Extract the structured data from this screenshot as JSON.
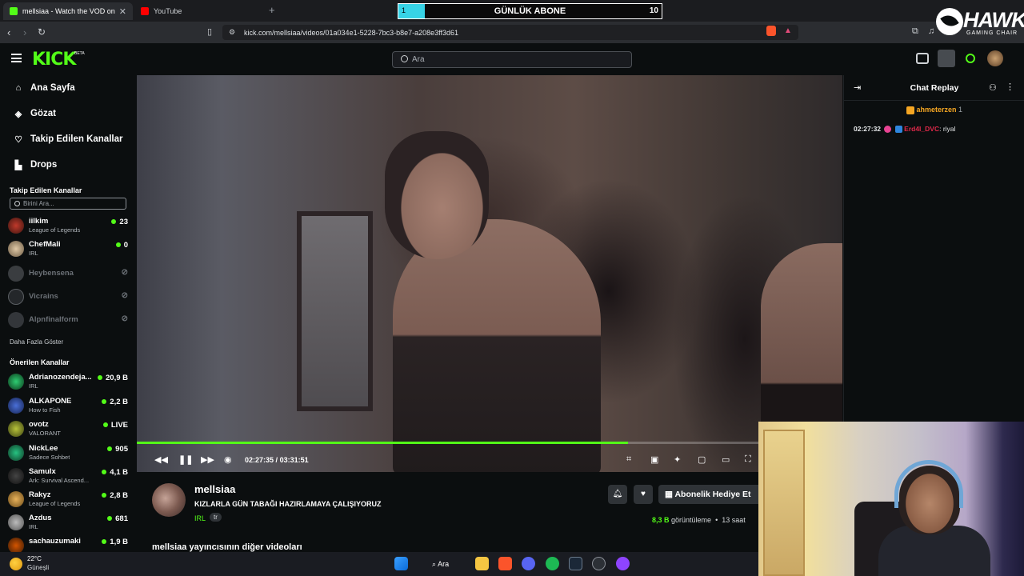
{
  "browser": {
    "tabs": [
      {
        "title": "mellsiaa - Watch the VOD on",
        "favicon_color": "#53fc18",
        "active": true
      },
      {
        "title": "YouTube",
        "favicon_color": "#ff0000",
        "active": false
      }
    ],
    "url": "kick.com/mellsiaa/videos/01a034e1-5228-7bc3-b8e7-a208e3ff3d61"
  },
  "sub_goal": {
    "current": "1",
    "title": "GÜNLÜK ABONE",
    "goal": "10",
    "progress": 0.1
  },
  "overlay_logo": {
    "name": "HAWK",
    "tagline": "GAMING CHAIR"
  },
  "header": {
    "logo": "KICK",
    "beta": "BETA",
    "search_placeholder": "Ara"
  },
  "sidebar": {
    "nav": [
      {
        "label": "Ana Sayfa",
        "icon": "home-icon"
      },
      {
        "label": "Gözat",
        "icon": "compass-icon"
      },
      {
        "label": "Takip Edilen Kanallar",
        "icon": "heart-icon"
      },
      {
        "label": "Drops",
        "icon": "drops-icon"
      }
    ],
    "followed_title": "Takip Edilen Kanallar",
    "followed_search_placeholder": "Birini Ara...",
    "followed": [
      {
        "name": "iilkim",
        "category": "League of Legends",
        "viewers": "23",
        "live": true
      },
      {
        "name": "ChefMali",
        "category": "IRL",
        "viewers": "0",
        "live": true
      },
      {
        "name": "Heybensena",
        "category": "",
        "viewers": "",
        "live": false
      },
      {
        "name": "Vicrains",
        "category": "",
        "viewers": "",
        "live": false
      },
      {
        "name": "Alpnfinalform",
        "category": "",
        "viewers": "",
        "live": false
      }
    ],
    "show_more": "Daha Fazla Göster",
    "recommended_title": "Önerilen Kanallar",
    "recommended": [
      {
        "name": "Adrianozendeja...",
        "category": "IRL",
        "viewers": "20,9 B"
      },
      {
        "name": "ALKAPONE",
        "category": "How to Fish",
        "viewers": "2,2 B"
      },
      {
        "name": "ovotz",
        "category": "VALORANT",
        "viewers": "LIVE"
      },
      {
        "name": "NickLee",
        "category": "Sadece Sohbet",
        "viewers": "905"
      },
      {
        "name": "Samulx",
        "category": "Ark: Survival Ascend...",
        "viewers": "4,1 B"
      },
      {
        "name": "Rakyz",
        "category": "League of Legends",
        "viewers": "2,8 B"
      },
      {
        "name": "Azdus",
        "category": "IRL",
        "viewers": "681"
      },
      {
        "name": "sachauzumaki",
        "category": "",
        "viewers": "1,9 B"
      }
    ]
  },
  "player": {
    "current_time": "02:27:35",
    "duration": "03:31:51",
    "time_sep": "/",
    "progress": 0.696
  },
  "video_info": {
    "streamer": "mellsiaa",
    "title": "KIZLARLA GÜN TABAĞI HAZIRLAMAYA ÇALIŞIYORUZ",
    "category": "IRL",
    "language": "tr",
    "gift_label": "Abonelik Hediye Et",
    "views_count": "8,3 B",
    "views_label": "görüntüleme",
    "time_ago": "13 saat",
    "more_videos": "mellsiaa yayıncısının diğer videoları"
  },
  "chat": {
    "title": "Chat Replay",
    "pinned_user": "ahmeterzen",
    "pinned_count": "1",
    "messages": [
      {
        "time": "02:27:32",
        "user": "Erd4l_DVC",
        "user_color": "#e0294a",
        "text": "riyal"
      }
    ]
  },
  "taskbar": {
    "temp": "22°C",
    "weather": "Güneşli",
    "search_label": "Ara"
  }
}
